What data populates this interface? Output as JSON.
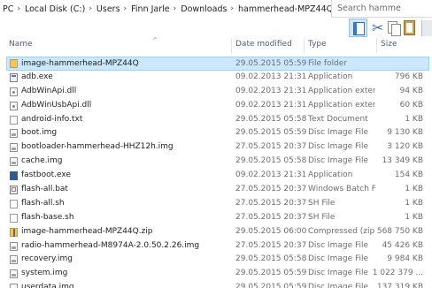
{
  "address_bar": {
    "crumbs": [
      "PC",
      "Local Disk (C:)",
      "Users",
      "Finn Jarle",
      "Downloads",
      "hammerhead-MPZ44Q"
    ],
    "separator": "›"
  },
  "search": {
    "placeholder": "Search hamme"
  },
  "ribbon": {
    "icons": [
      "details-pane-icon",
      "cut-icon",
      "copy-icon",
      "paste-icon"
    ]
  },
  "columns": {
    "name": "Name",
    "date_modified": "Date modified",
    "type": "Type",
    "size": "Size",
    "sort_indicator": "^"
  },
  "files": [
    {
      "name": "image-hammerhead-MPZ44Q",
      "date": "29.05.2015 05:59",
      "type": "File folder",
      "size": "",
      "icon": "folder-icon",
      "selected": true
    },
    {
      "name": "adb.exe",
      "date": "09.02.2013 21:31",
      "type": "Application",
      "size": "796 KB",
      "icon": "exe-icon"
    },
    {
      "name": "AdbWinApi.dll",
      "date": "09.02.2013 21:31",
      "type": "Application extens...",
      "size": "94 KB",
      "icon": "dll-icon"
    },
    {
      "name": "AdbWinUsbApi.dll",
      "date": "09.02.2013 21:31",
      "type": "Application extens...",
      "size": "60 KB",
      "icon": "dll-icon"
    },
    {
      "name": "android-info.txt",
      "date": "29.05.2015 05:58",
      "type": "Text Document",
      "size": "1 KB",
      "icon": "text-file-icon"
    },
    {
      "name": "boot.img",
      "date": "29.05.2015 05:59",
      "type": "Disc Image File",
      "size": "9 130 KB",
      "icon": "disc-image-icon"
    },
    {
      "name": "bootloader-hammerhead-HHZ12h.img",
      "date": "27.05.2015 20:37",
      "type": "Disc Image File",
      "size": "3 120 KB",
      "icon": "disc-image-icon"
    },
    {
      "name": "cache.img",
      "date": "29.05.2015 05:58",
      "type": "Disc Image File",
      "size": "13 349 KB",
      "icon": "disc-image-icon"
    },
    {
      "name": "fastboot.exe",
      "date": "09.02.2013 21:31",
      "type": "Application",
      "size": "154 KB",
      "icon": "fastboot-icon"
    },
    {
      "name": "flash-all.bat",
      "date": "27.05.2015 20:37",
      "type": "Windows Batch File",
      "size": "1 KB",
      "icon": "batch-file-icon"
    },
    {
      "name": "flash-all.sh",
      "date": "27.05.2015 20:37",
      "type": "SH File",
      "size": "1 KB",
      "icon": "text-file-icon"
    },
    {
      "name": "flash-base.sh",
      "date": "27.05.2015 20:37",
      "type": "SH File",
      "size": "1 KB",
      "icon": "text-file-icon"
    },
    {
      "name": "image-hammerhead-MPZ44Q.zip",
      "date": "29.05.2015 06:00",
      "type": "Compressed (zipp...",
      "size": "568 750 KB",
      "icon": "zip-folder-icon"
    },
    {
      "name": "radio-hammerhead-M8974A-2.0.50.2.26.img",
      "date": "27.05.2015 20:37",
      "type": "Disc Image File",
      "size": "45 426 KB",
      "icon": "disc-image-icon"
    },
    {
      "name": "recovery.img",
      "date": "29.05.2015 05:58",
      "type": "Disc Image File",
      "size": "9 984 KB",
      "icon": "disc-image-icon"
    },
    {
      "name": "system.img",
      "date": "29.05.2015 05:59",
      "type": "Disc Image File",
      "size": "1 022 379 ...",
      "icon": "disc-image-icon"
    },
    {
      "name": "userdata.img",
      "date": "29.05.2015 05:59",
      "type": "Disc Image File",
      "size": "137 319 KB",
      "icon": "disc-image-icon"
    }
  ]
}
